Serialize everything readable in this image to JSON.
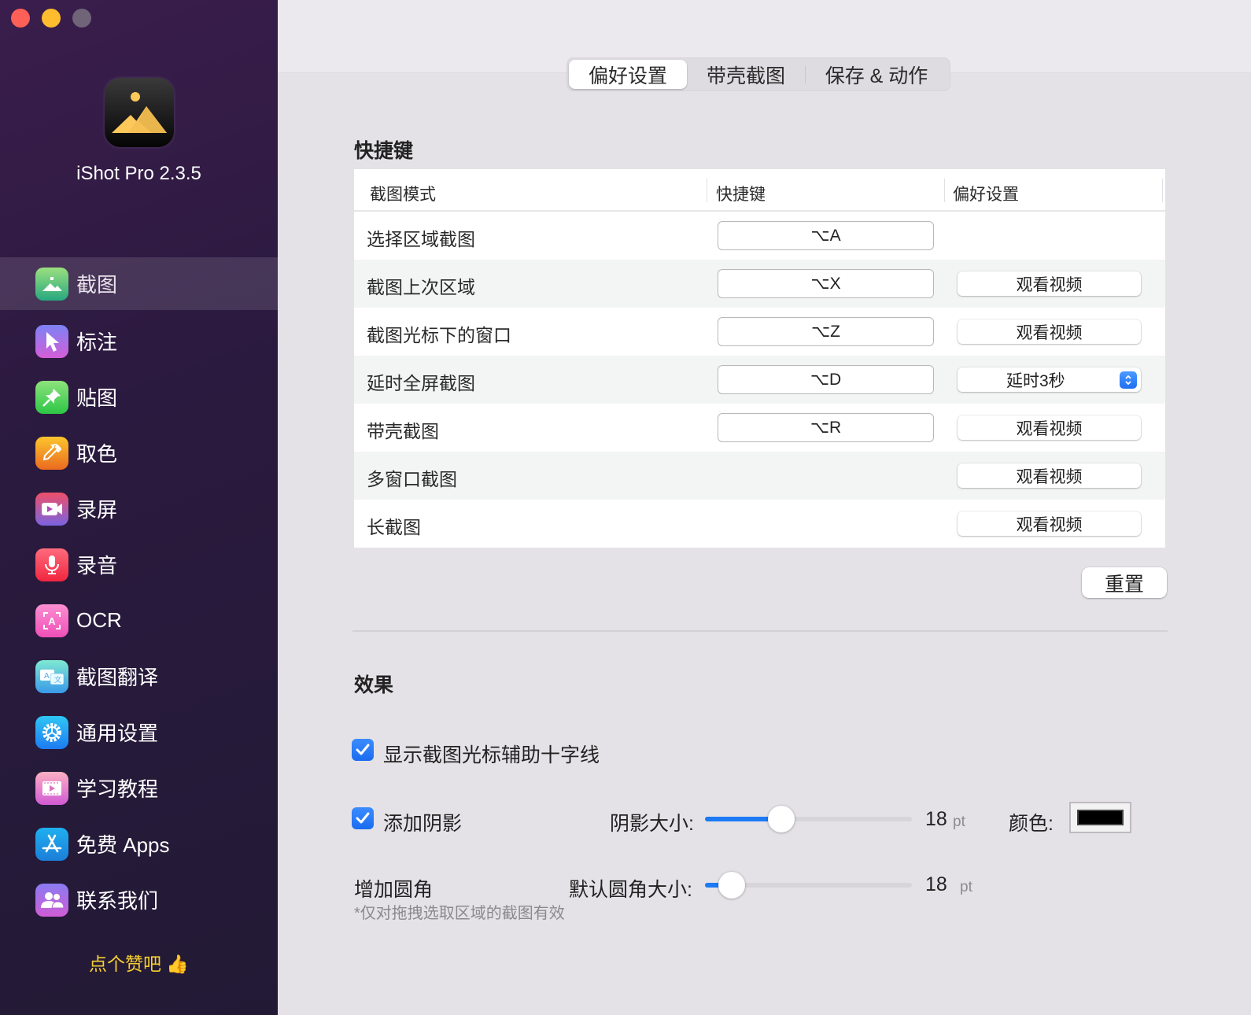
{
  "window": {
    "controls": [
      "close",
      "minimize",
      "maximize"
    ]
  },
  "sidebar": {
    "app_name": "iShot Pro 2.3.5",
    "items": [
      {
        "label": "截图",
        "icon": "screenshot-icon",
        "active": true
      },
      {
        "label": "标注",
        "icon": "annotate-cursor-icon"
      },
      {
        "label": "贴图",
        "icon": "pin-icon"
      },
      {
        "label": "取色",
        "icon": "eyedropper-icon"
      },
      {
        "label": "录屏",
        "icon": "video-camera-icon"
      },
      {
        "label": "录音",
        "icon": "microphone-icon"
      },
      {
        "label": "OCR",
        "icon": "ocr-text-icon"
      },
      {
        "label": "截图翻译",
        "icon": "translate-icon"
      },
      {
        "label": "通用设置",
        "icon": "gear-icon"
      },
      {
        "label": "学习教程",
        "icon": "film-play-icon"
      },
      {
        "label": "免费 Apps",
        "icon": "app-store-icon"
      },
      {
        "label": "联系我们",
        "icon": "people-icon"
      }
    ],
    "like_text": "点个赞吧 👍"
  },
  "tabs": [
    {
      "label": "偏好设置",
      "active": true
    },
    {
      "label": "带壳截图"
    },
    {
      "label": "保存 & 动作"
    }
  ],
  "shortcuts": {
    "title": "快捷键",
    "columns": [
      "截图模式",
      "快捷键",
      "偏好设置"
    ],
    "rows": [
      {
        "mode": "选择区域截图",
        "shortcut": "⌥A",
        "pref": null
      },
      {
        "mode": "截图上次区域",
        "shortcut": "⌥X",
        "pref": "观看视频"
      },
      {
        "mode": "截图光标下的窗口",
        "shortcut": "⌥Z",
        "pref": "观看视频"
      },
      {
        "mode": "延时全屏截图",
        "shortcut": "⌥D",
        "pref": "延时3秒",
        "pref_type": "select"
      },
      {
        "mode": "带壳截图",
        "shortcut": "⌥R",
        "pref": "观看视频"
      },
      {
        "mode": "多窗口截图",
        "shortcut": null,
        "pref": "观看视频"
      },
      {
        "mode": "长截图",
        "shortcut": null,
        "pref": "观看视频"
      }
    ],
    "reset_label": "重置"
  },
  "effects": {
    "title": "效果",
    "crosshair": {
      "label": "显示截图光标辅助十字线",
      "checked": true
    },
    "shadow": {
      "label": "添加阴影",
      "checked": true,
      "size_label": "阴影大小:",
      "size_value": 18,
      "size_fraction": 0.37,
      "unit": "pt",
      "color_label": "颜色:",
      "color": "#000000"
    },
    "corner": {
      "label": "增加圆角",
      "size_label": "默认圆角大小:",
      "size_value": 18,
      "size_fraction": 0.13,
      "unit": "pt",
      "note": "*仅对拖拽选取区域的截图有效"
    }
  },
  "colors": {
    "accent": "#1d7af5",
    "like_text": "#f7cf2f"
  }
}
